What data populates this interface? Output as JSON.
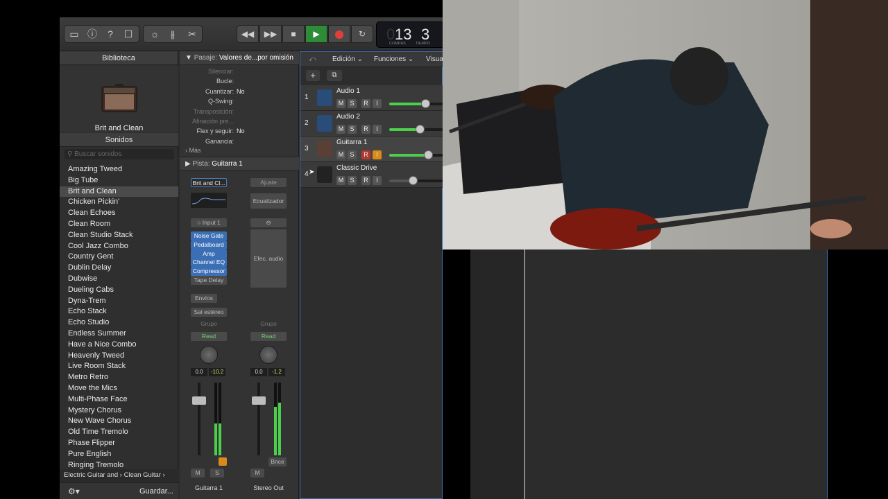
{
  "toolbar": {
    "lcd": {
      "bar": "13",
      "beat": "3",
      "bar_caption": "COMPÁS",
      "beat_caption": "TIEMPO",
      "lead_digit": "0"
    }
  },
  "library": {
    "title": "Biblioteca",
    "patch_name": "Brit and Clean",
    "sounds_header": "Sonidos",
    "search_placeholder": "Buscar sonidos",
    "items": [
      "Amazing Tweed",
      "Big Tube",
      "Brit and Clean",
      "Chicken Pickin'",
      "Clean Echoes",
      "Clean Room",
      "Clean Studio Stack",
      "Cool Jazz Combo",
      "Country Gent",
      "Dublin Delay",
      "Dubwise",
      "Dueling Cabs",
      "Dyna-Trem",
      "Echo Stack",
      "Echo Studio",
      "Endless Summer",
      "Have a Nice Combo",
      "Heavenly Tweed",
      "Live Room Stack",
      "Metro Retro",
      "Move the Mics",
      "Multi-Phase Face",
      "Mystery Chorus",
      "New Wave Chorus",
      "Old Time Tremolo",
      "Phase Flipper",
      "Pure English",
      "Ringing Tremolo"
    ],
    "selected_index": 2,
    "breadcrumb_a": "Electric Guitar and",
    "breadcrumb_b": "Clean Guitar",
    "save_label": "Guardar..."
  },
  "inspector": {
    "region_header_label": "Pasaje:",
    "region_header_value": "Valores de...por omisión",
    "rows": [
      {
        "label": "Silenciar:",
        "value": "",
        "dim": true
      },
      {
        "label": "Bucle:",
        "value": "",
        "dim": false
      },
      {
        "label": "Cuantizar:",
        "value": "No",
        "dim": false
      },
      {
        "label": "Q-Swing:",
        "value": "",
        "dim": false
      },
      {
        "label": "Transposición:",
        "value": "",
        "dim": true
      },
      {
        "label": "Afinación pre...",
        "value": "",
        "dim": true
      },
      {
        "label": "Flex y seguir:",
        "value": "No",
        "dim": false
      },
      {
        "label": "Ganancia:",
        "value": "",
        "dim": false
      }
    ],
    "more_label": "Más",
    "track_header_label": "Pista:",
    "track_header_value": "Guitarra 1",
    "strip1": {
      "patch": "Brit and Cl...",
      "input": "Input 1",
      "plugins": [
        "Noise Gate",
        "Pedalboard",
        "Amp",
        "Channel EQ",
        "Compressor",
        "Tape Delay"
      ],
      "sends": "Envíos",
      "output": "Sal estéreo",
      "group": "Grupo",
      "automation": "Read",
      "vol": "0.0",
      "peak": "-10.2",
      "mute": "M",
      "solo": "S",
      "name": "Guitarra 1"
    },
    "strip2": {
      "setting": "Ajuste",
      "eq": "Ecualizador",
      "fx": "Efec. audio",
      "group": "Grupo",
      "automation": "Read",
      "vol": "0.0",
      "peak": "-1.2",
      "bounce": "Bnce",
      "mute": "M",
      "name": "Stereo Out"
    }
  },
  "tracks": {
    "menu": [
      "Edición",
      "Funciones",
      "Visua"
    ],
    "list": [
      {
        "num": "1",
        "name": "Audio 1",
        "type": "audio",
        "vol": 0.65,
        "selected": false
      },
      {
        "num": "2",
        "name": "Audio 2",
        "type": "audio",
        "vol": 0.55,
        "selected": false
      },
      {
        "num": "3",
        "name": "Guitarra 1",
        "type": "amp",
        "vol": 0.7,
        "selected": true
      },
      {
        "num": "4",
        "name": "Classic Drive",
        "type": "amp2",
        "vol": 0.42,
        "selected": false
      }
    ],
    "btn_m": "M",
    "btn_s": "S",
    "btn_r": "R",
    "btn_i": "I"
  },
  "colors": {
    "accent": "#3b6fb5",
    "green": "#4cd04c",
    "record": "#e0403a",
    "play": "#2e8b37"
  }
}
